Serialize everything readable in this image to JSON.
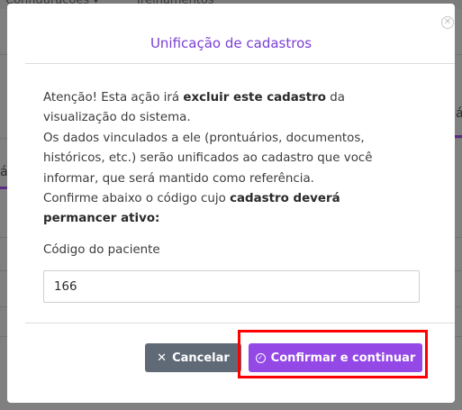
{
  "background": {
    "menu_items": [
      "Configurações ▾",
      "Treinamentos"
    ],
    "side_chars": [
      "á",
      "á"
    ]
  },
  "modal": {
    "title": "Unificação de cadastros",
    "close_icon": "close-circle-icon",
    "message": {
      "line1_a": "Atenção! Esta ação irá ",
      "line1_b": "excluir este cadastro",
      "line1_c": " da",
      "line2": "visualização do sistema.",
      "line3": "Os dados vinculados a ele (prontuários, documentos,",
      "line4": "históricos, etc.) serão unificados ao cadastro que você",
      "line5": "informar, que será mantido como referência.",
      "line6_a": "Confirme abaixo o código cujo ",
      "line6_b": "cadastro deverá",
      "line7": "permancer ativo:"
    },
    "field": {
      "label": "Código do paciente",
      "value": "166"
    },
    "buttons": {
      "cancel": "Cancelar",
      "confirm": "Confirmar e continuar"
    }
  },
  "colors": {
    "accent": "#9448e6",
    "title": "#7b3fd6",
    "cancel": "#5f6a76",
    "highlight": "#ff0000"
  }
}
